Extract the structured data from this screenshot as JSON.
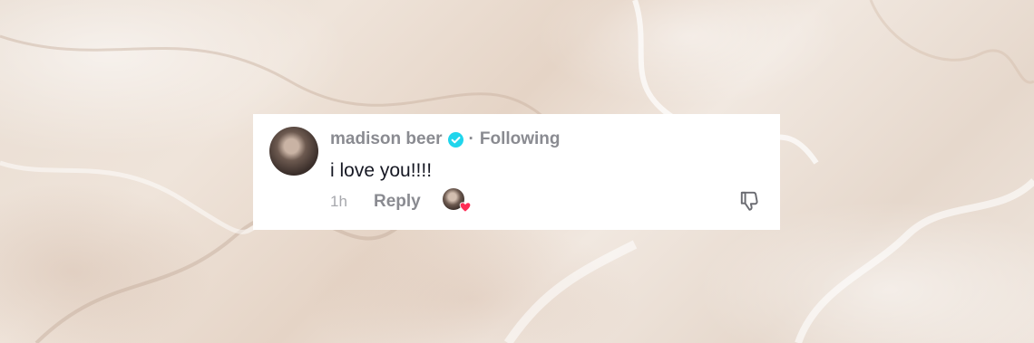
{
  "comment": {
    "username": "madison beer",
    "separator": "·",
    "follow_status": "Following",
    "text": "i love you!!!!",
    "timestamp": "1h",
    "reply_label": "Reply",
    "verified": true,
    "liked_by_creator": true
  },
  "icons": {
    "verified": "verified-check-icon",
    "creator_like": "heart-icon",
    "dislike": "thumbs-down-icon"
  },
  "colors": {
    "username": "#8a8b91",
    "comment_text": "#161823",
    "verified_badge": "#20d5ec",
    "heart": "#fe2c55",
    "card_background": "#ffffff"
  }
}
